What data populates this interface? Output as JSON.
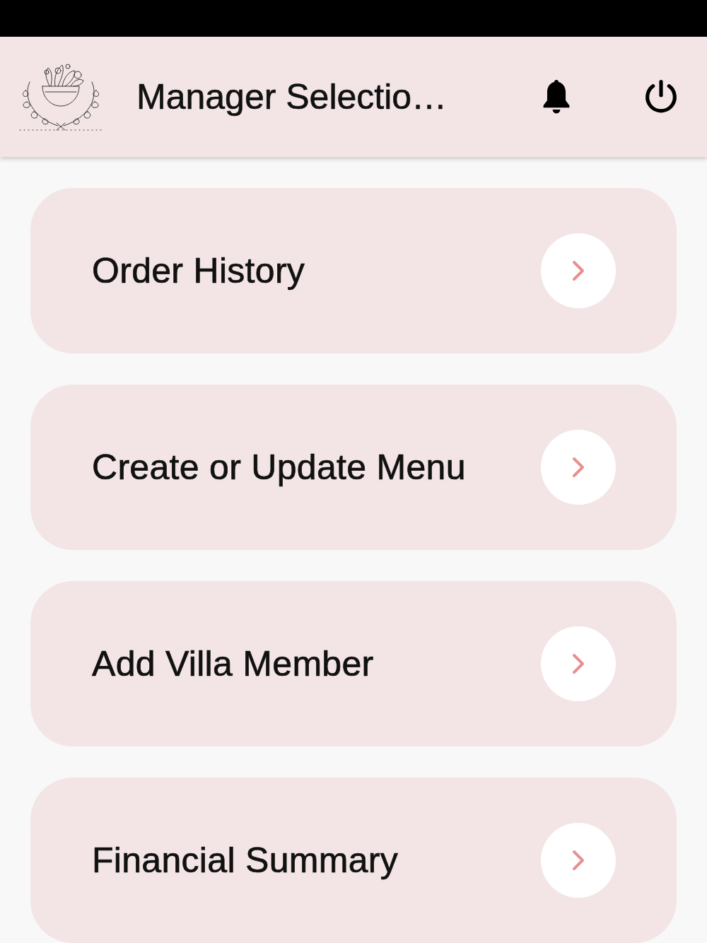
{
  "header": {
    "title": "Manager Selectio…"
  },
  "menu_items": [
    {
      "label": "Order History"
    },
    {
      "label": "Create or Update Menu"
    },
    {
      "label": "Add Villa Member"
    },
    {
      "label": "Financial Summary"
    }
  ]
}
